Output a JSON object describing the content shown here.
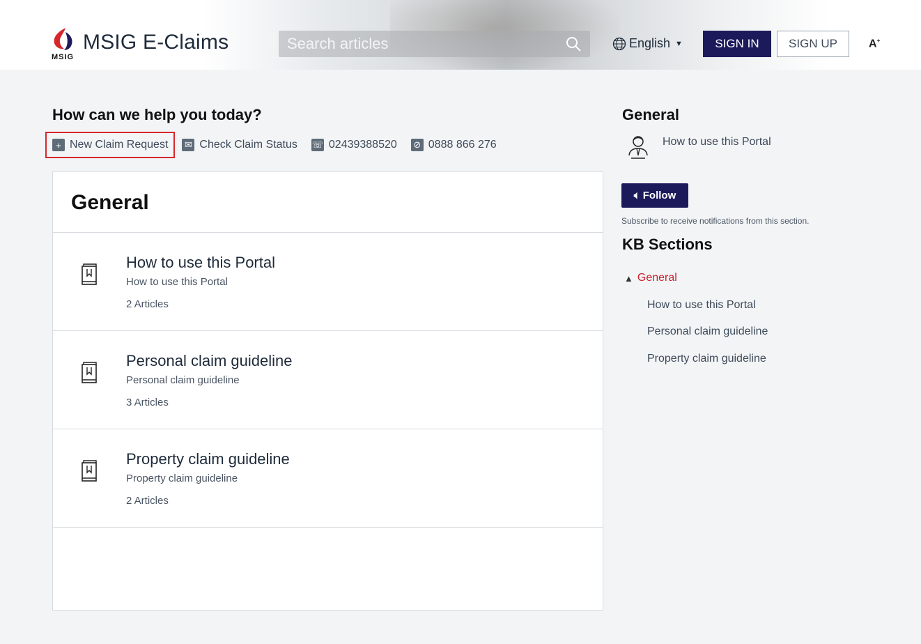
{
  "header": {
    "brand_small": "MSIG",
    "title": "MSIG E-Claims",
    "search_placeholder": "Search articles",
    "language": "English",
    "sign_in": "SIGN IN",
    "sign_up": "SIGN UP",
    "text_size": "A"
  },
  "help": {
    "heading": "How can we help you today?",
    "links": [
      {
        "label": "New Claim Request",
        "icon": "plus-icon"
      },
      {
        "label": "Check Claim Status",
        "icon": "mail-icon"
      },
      {
        "label": "02439388520",
        "icon": "phone-icon"
      },
      {
        "label": "0888 866 276",
        "icon": "mobile-icon"
      }
    ]
  },
  "panel": {
    "title": "General",
    "categories": [
      {
        "title": "How to use this Portal",
        "subtitle": "How to use this Portal",
        "count": "2 Articles"
      },
      {
        "title": "Personal claim guideline",
        "subtitle": "Personal claim guideline",
        "count": "3 Articles"
      },
      {
        "title": "Property claim guideline",
        "subtitle": "Property claim guideline",
        "count": "2 Articles"
      }
    ]
  },
  "sidebar": {
    "heading": "General",
    "top_link": "How to use this Portal",
    "follow": "Follow",
    "subscribe_note": "Subscribe to receive notifications from this section.",
    "kb_heading": "KB Sections",
    "kb_active": "General",
    "kb_items": [
      "How to use this Portal",
      "Personal claim guideline",
      "Property claim guideline"
    ]
  },
  "colors": {
    "brand_navy": "#1d1a5c",
    "accent_red": "#c8202f",
    "selected_border": "#d6282b"
  }
}
